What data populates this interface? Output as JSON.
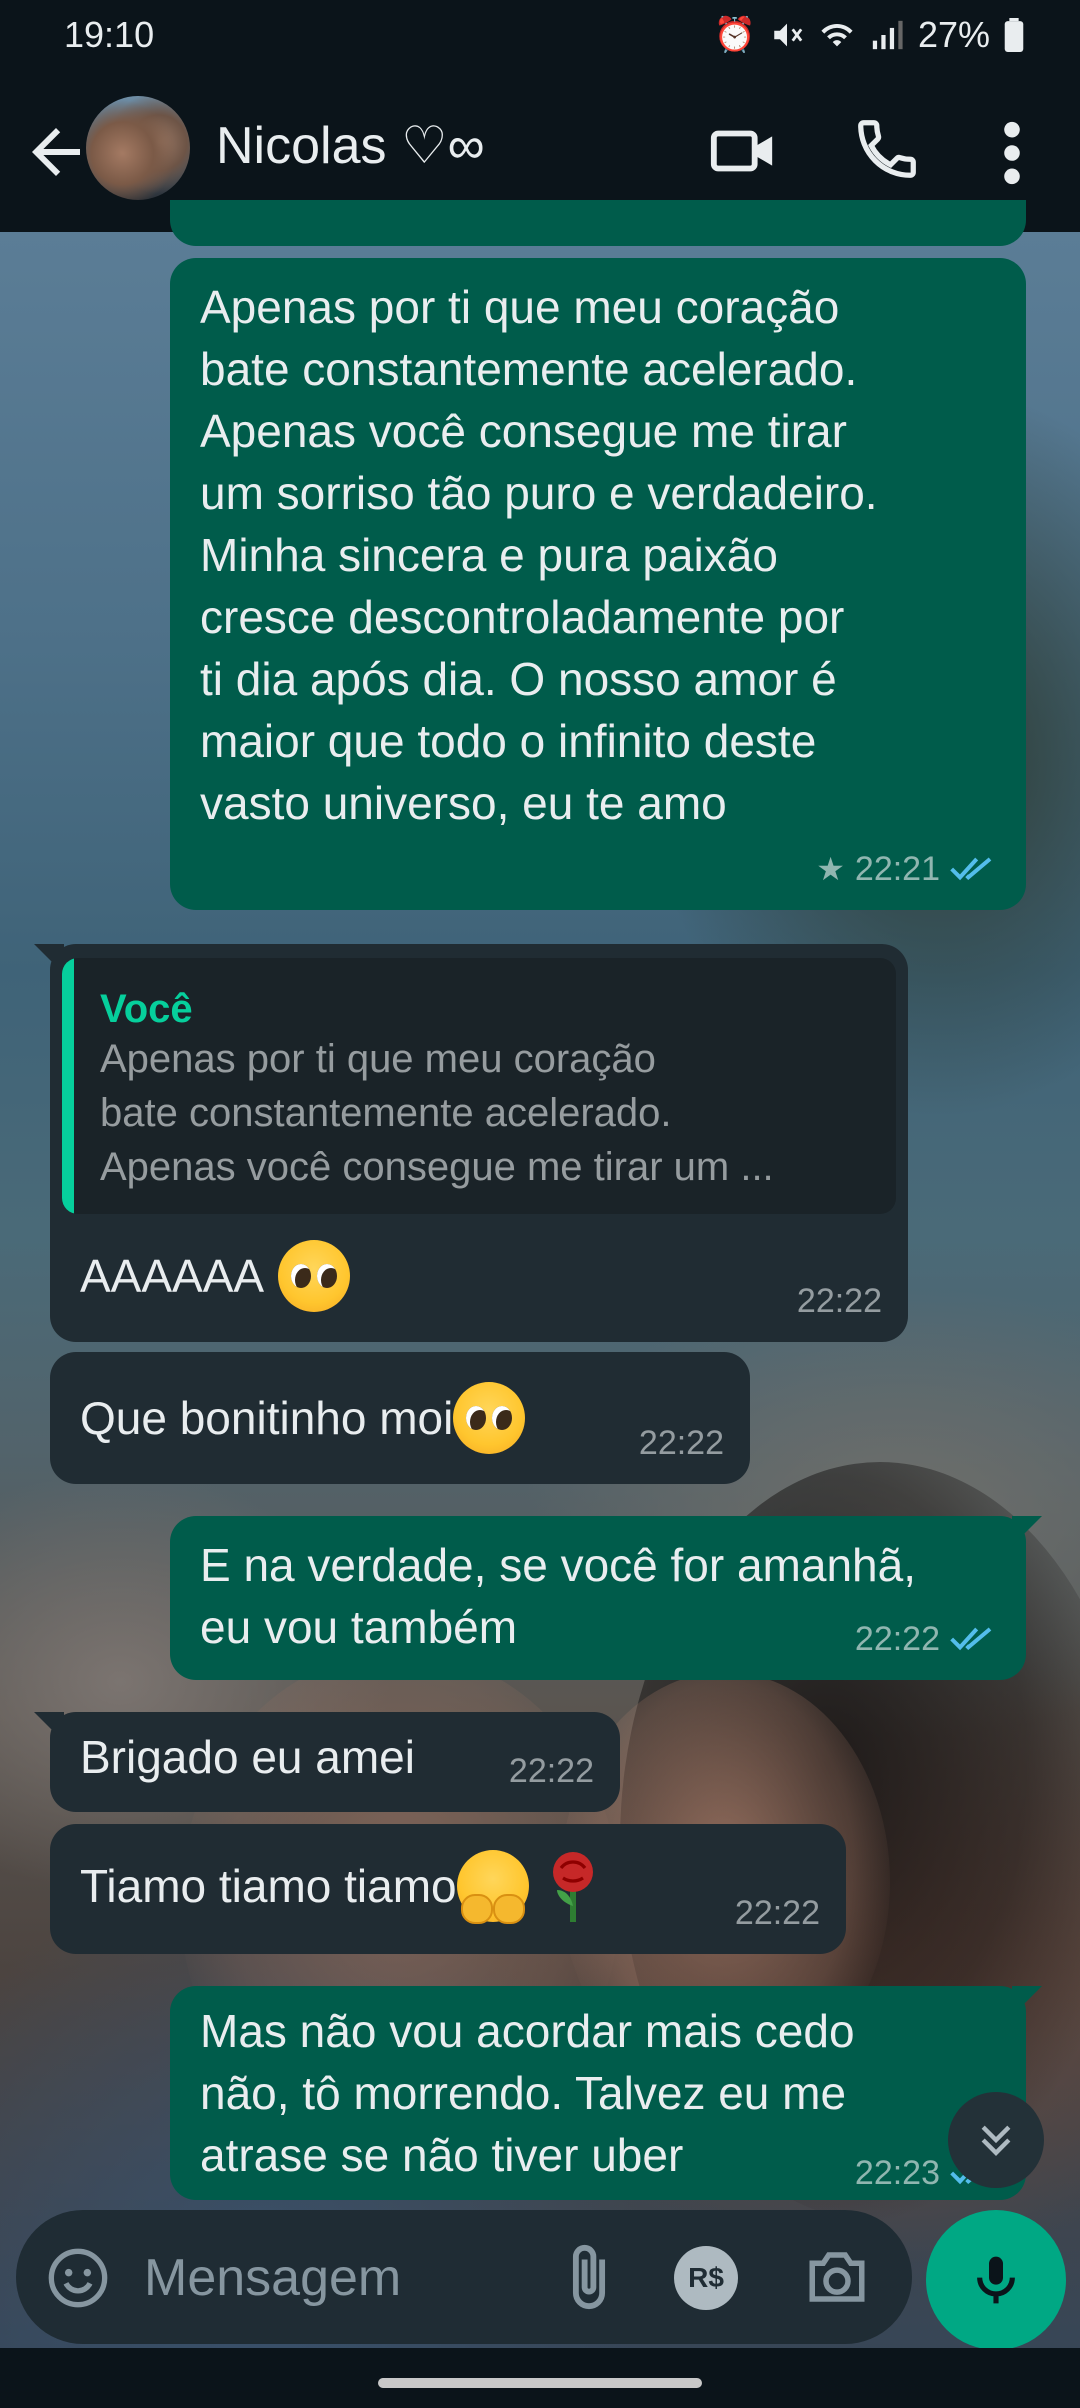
{
  "status_bar": {
    "time": "19:10",
    "battery": "27%",
    "icons": [
      "alarm-icon",
      "mute-icon",
      "wifi-icon",
      "signal-icon",
      "battery-icon"
    ]
  },
  "header": {
    "contact_name": "Nicolas ♡∞",
    "icons": [
      "back-arrow-icon",
      "video-call-icon",
      "voice-call-icon",
      "more-options-icon"
    ]
  },
  "messages": [
    {
      "direction": "outgoing",
      "text": "Apenas por ti que meu coração\nbate constantemente acelerado.\nApenas você consegue me tirar\num sorriso tão puro e verdadeiro.\nMinha sincera e pura paixão\ncresce descontroladamente por\nti dia após dia. O nosso amor é\nmaior que todo o infinito deste\nvasto universo, eu te amo",
      "time": "22:21",
      "starred": true,
      "read": true
    },
    {
      "direction": "incoming",
      "quote_author": "Você",
      "quote_text": "Apenas por ti que meu coração\nbate constantemente acelerado.\nApenas você consegue me tirar um ...",
      "text": "AAAAAA",
      "emoji": "pleading-face",
      "time": "22:22"
    },
    {
      "direction": "incoming",
      "text": "Que bonitinho moi",
      "emoji": "pleading-face",
      "time": "22:22"
    },
    {
      "direction": "outgoing",
      "text": "E na verdade, se você for amanhã,\neu vou também",
      "time": "22:22",
      "read": true
    },
    {
      "direction": "incoming",
      "text": "Brigado eu amei",
      "time": "22:22"
    },
    {
      "direction": "incoming",
      "text": "Tiamo tiamo tiamo",
      "emoji": "hugging-face, rose",
      "time": "22:22"
    },
    {
      "direction": "outgoing",
      "text": "Mas não vou acordar mais cedo\nnão, tô morrendo. Talvez eu me\natrase se não tiver uber",
      "time": "22:23",
      "read": true
    }
  ],
  "composer": {
    "placeholder": "Mensagem",
    "payment_label": "R$",
    "icons": [
      "emoji-icon",
      "attach-icon",
      "payment-icon",
      "camera-icon",
      "mic-icon"
    ]
  },
  "colors": {
    "outgoing_bubble": "#005c4b",
    "incoming_bubble": "#202c33",
    "accent": "#00a884",
    "read_tick": "#53bdeb"
  }
}
